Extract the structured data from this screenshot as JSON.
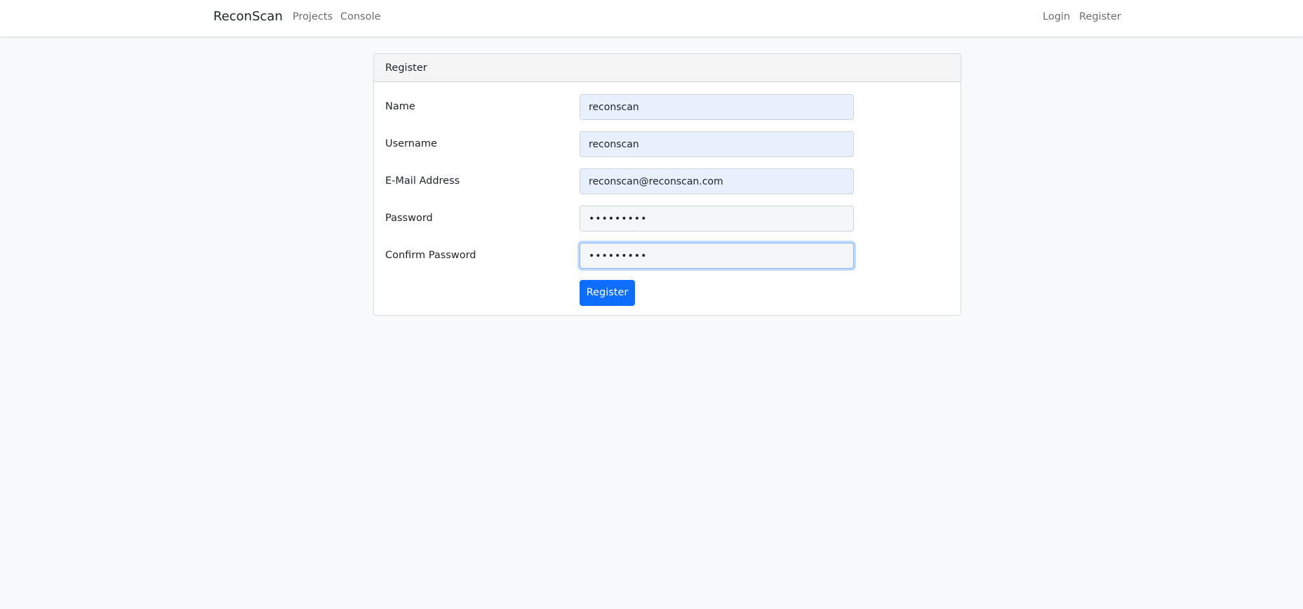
{
  "navbar": {
    "brand": "ReconScan",
    "left_links": [
      "Projects",
      "Console"
    ],
    "right_links": [
      "Login",
      "Register"
    ]
  },
  "card": {
    "header": "Register",
    "fields": [
      {
        "label": "Name",
        "value": "reconscan",
        "type": "text"
      },
      {
        "label": "Username",
        "value": "reconscan",
        "type": "text"
      },
      {
        "label": "E-Mail Address",
        "value": "reconscan@reconscan.com",
        "type": "email"
      },
      {
        "label": "Password",
        "value": "•••••••••",
        "type": "password"
      },
      {
        "label": "Confirm Password",
        "value": "•••••••••",
        "type": "password"
      }
    ],
    "submit_label": "Register"
  },
  "colors": {
    "primary": "#0d6efd",
    "autofill": "#e8f0fe",
    "page_bg": "#f8f9fa"
  }
}
